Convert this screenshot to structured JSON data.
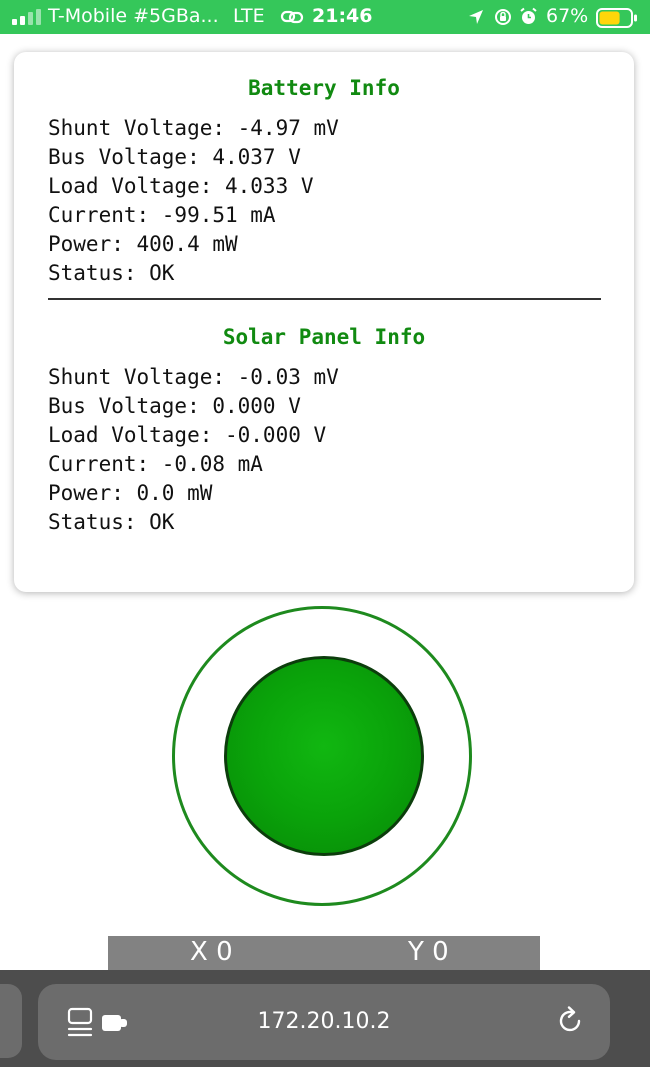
{
  "status_bar": {
    "carrier": "T-Mobile #5GBa...",
    "network": "LTE",
    "time": "21:46",
    "battery_percent": "67%",
    "battery_level": 0.67,
    "icons": [
      "signal-icon",
      "link-icon",
      "location-icon",
      "rotation-lock-icon",
      "alarm-icon",
      "battery-icon"
    ],
    "background_color": "#35c75a"
  },
  "battery": {
    "title": "Battery Info",
    "lines": [
      "Shunt Voltage: -4.97 mV",
      "Bus Voltage: 4.037 V",
      "Load Voltage: 4.033 V",
      "Current: -99.51 mA",
      "Power: 400.4 mW",
      "Status: OK"
    ]
  },
  "solar": {
    "title": "Solar Panel Info",
    "lines": [
      "Shunt Voltage: -0.03 mV",
      "Bus Voltage: 0.000 V",
      "Load Voltage: -0.000 V",
      "Current: -0.08 mA",
      "Power: 0.0 mW",
      "Status: OK"
    ]
  },
  "joystick": {
    "knob_color": "#0aa30a",
    "ring_color": "#1e8a1e"
  },
  "coordinates": {
    "x": "X 0",
    "y": "Y 0"
  },
  "browser": {
    "url": "172.20.10.2",
    "icons": [
      "page-menu-icon",
      "extension-icon",
      "reload-icon"
    ]
  },
  "colors": {
    "heading": "#118a11",
    "coord_bar": "#828282",
    "browser_bar": "#4d4d4d"
  }
}
